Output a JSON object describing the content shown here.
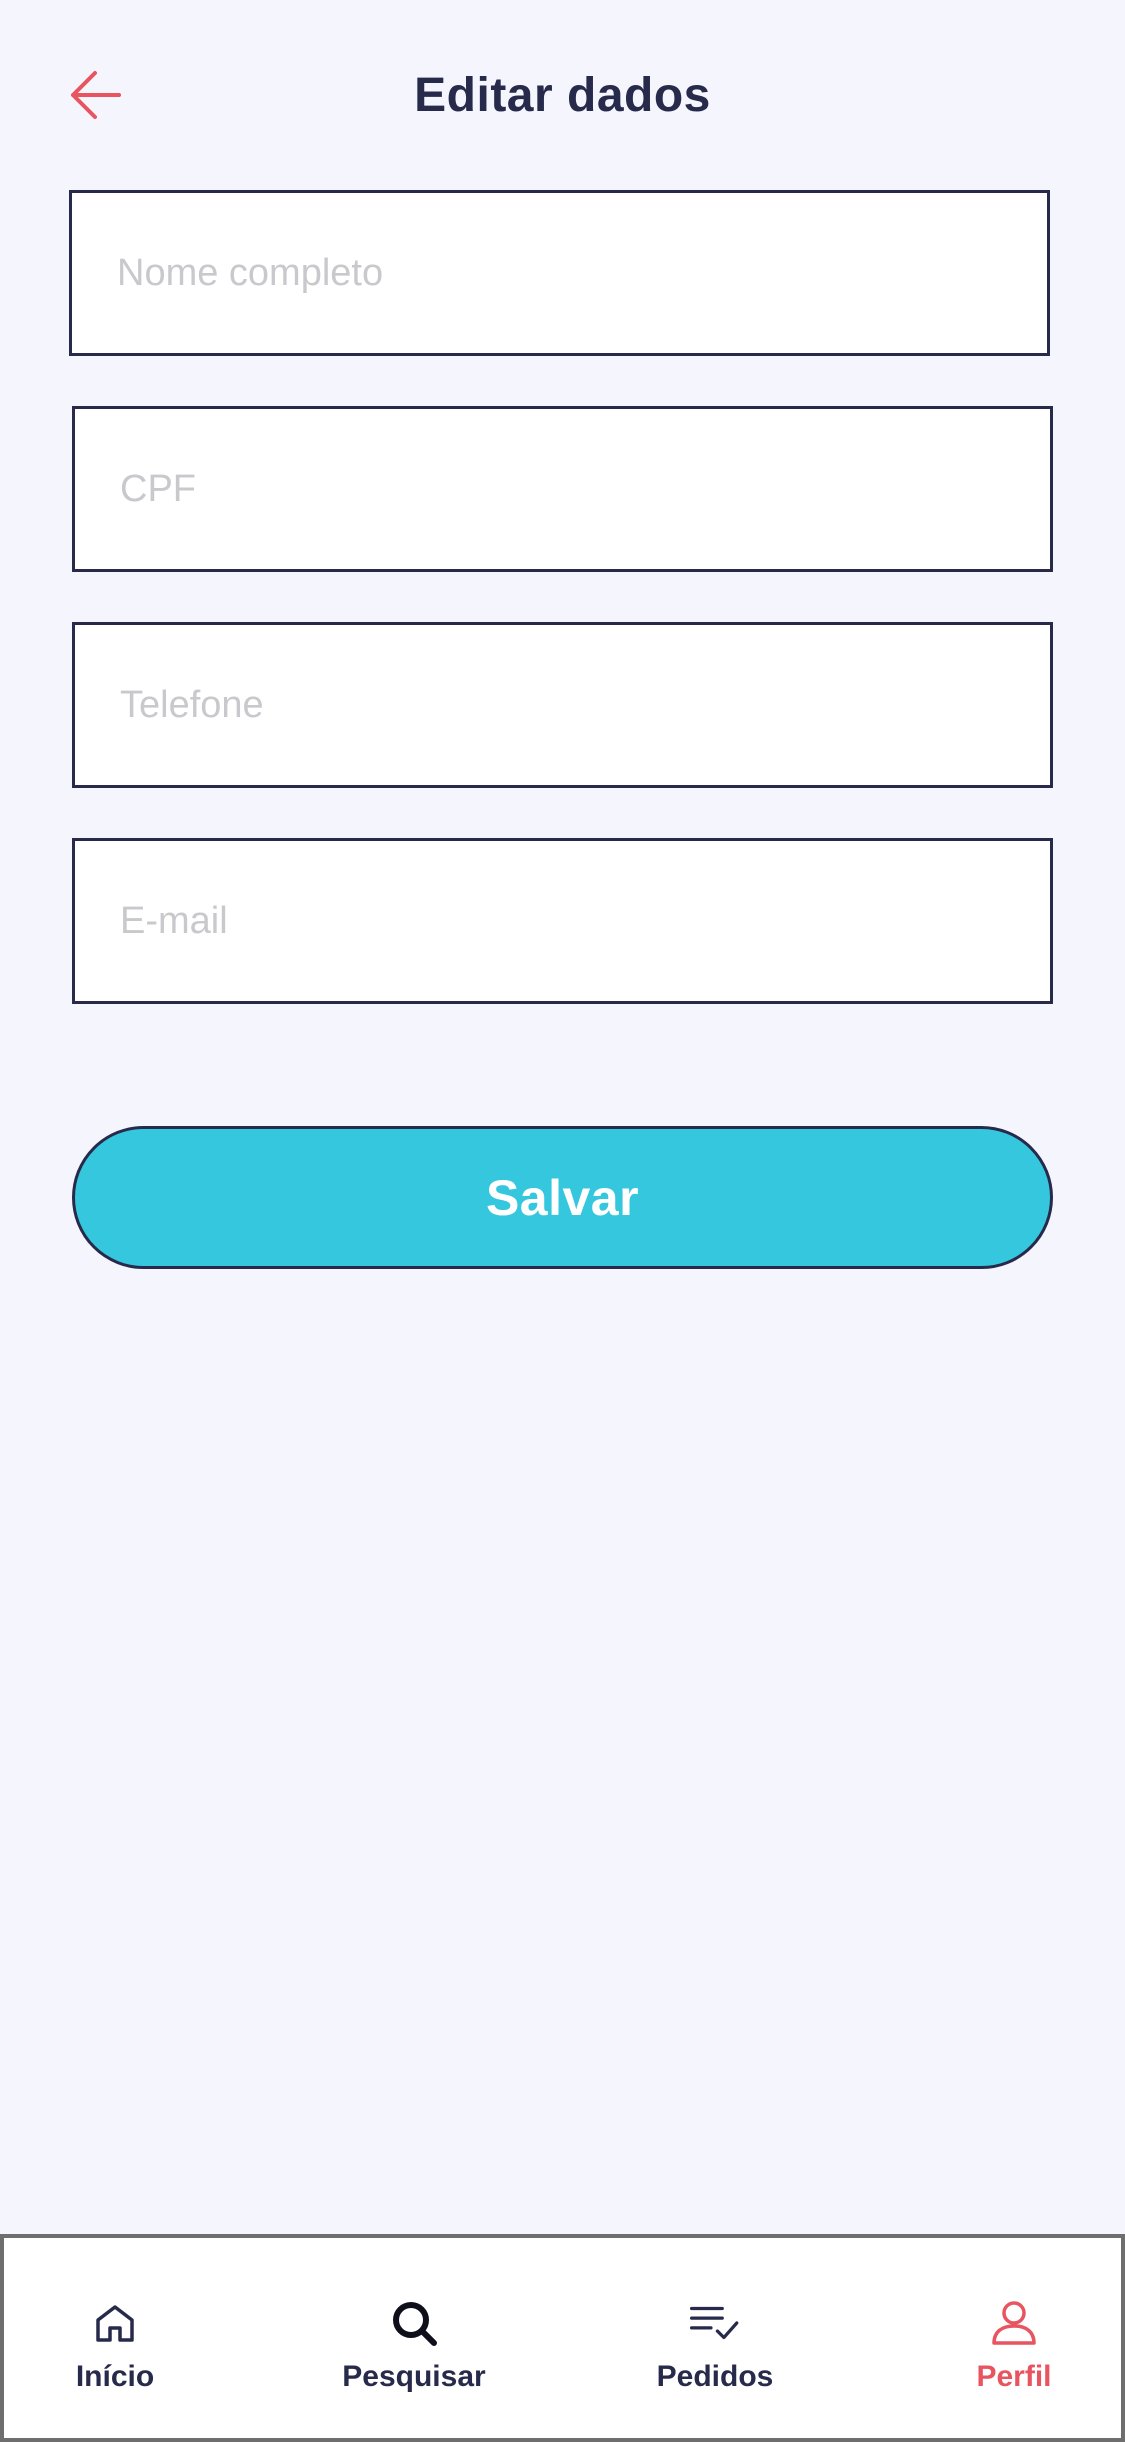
{
  "header": {
    "title": "Editar dados",
    "back_icon": "arrow-left-icon"
  },
  "form": {
    "fields": [
      {
        "name": "nome",
        "placeholder": "Nome completo",
        "value": ""
      },
      {
        "name": "cpf",
        "placeholder": "CPF",
        "value": ""
      },
      {
        "name": "telefone",
        "placeholder": "Telefone",
        "value": ""
      },
      {
        "name": "email",
        "placeholder": "E-mail",
        "value": ""
      }
    ],
    "save_label": "Salvar"
  },
  "tabbar": {
    "active": "Perfil",
    "items": [
      {
        "label": "Início",
        "icon": "home-icon"
      },
      {
        "label": "Pesquisar",
        "icon": "search-icon"
      },
      {
        "label": "Pedidos",
        "icon": "list-check-icon"
      },
      {
        "label": "Perfil",
        "icon": "person-icon"
      }
    ]
  },
  "colors": {
    "background": "#f5f6fd",
    "text": "#272a4a",
    "accent": "#35c7de",
    "active": "#e8545f",
    "placeholder": "#c9c9cd"
  }
}
